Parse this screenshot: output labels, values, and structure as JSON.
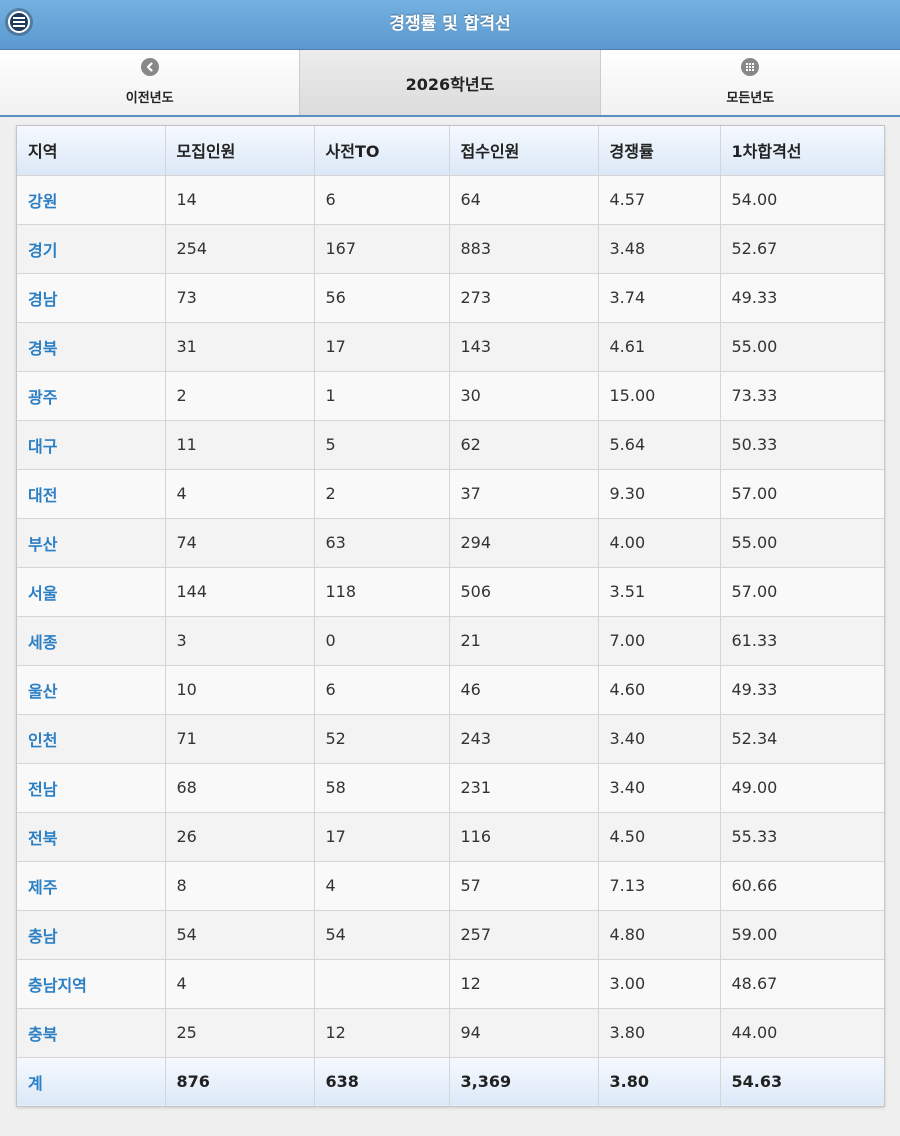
{
  "header": {
    "title": "경쟁률 및 합격선",
    "menu_icon": "menu-icon"
  },
  "nav": {
    "prev_label": "이전년도",
    "prev_icon": "chevron-left-icon",
    "current_label": "2026학년도",
    "all_label": "모든년도",
    "all_icon": "grid-icon"
  },
  "table": {
    "columns": [
      "지역",
      "모집인원",
      "사전TO",
      "접수인원",
      "경쟁률",
      "1차합격선"
    ],
    "rows": [
      [
        "강원",
        "14",
        "6",
        "64",
        "4.57",
        "54.00"
      ],
      [
        "경기",
        "254",
        "167",
        "883",
        "3.48",
        "52.67"
      ],
      [
        "경남",
        "73",
        "56",
        "273",
        "3.74",
        "49.33"
      ],
      [
        "경북",
        "31",
        "17",
        "143",
        "4.61",
        "55.00"
      ],
      [
        "광주",
        "2",
        "1",
        "30",
        "15.00",
        "73.33"
      ],
      [
        "대구",
        "11",
        "5",
        "62",
        "5.64",
        "50.33"
      ],
      [
        "대전",
        "4",
        "2",
        "37",
        "9.30",
        "57.00"
      ],
      [
        "부산",
        "74",
        "63",
        "294",
        "4.00",
        "55.00"
      ],
      [
        "서울",
        "144",
        "118",
        "506",
        "3.51",
        "57.00"
      ],
      [
        "세종",
        "3",
        "0",
        "21",
        "7.00",
        "61.33"
      ],
      [
        "울산",
        "10",
        "6",
        "46",
        "4.60",
        "49.33"
      ],
      [
        "인천",
        "71",
        "52",
        "243",
        "3.40",
        "52.34"
      ],
      [
        "전남",
        "68",
        "58",
        "231",
        "3.40",
        "49.00"
      ],
      [
        "전북",
        "26",
        "17",
        "116",
        "4.50",
        "55.33"
      ],
      [
        "제주",
        "8",
        "4",
        "57",
        "7.13",
        "60.66"
      ],
      [
        "충남",
        "54",
        "54",
        "257",
        "4.80",
        "59.00"
      ],
      [
        "충남지역",
        "4",
        "",
        "12",
        "3.00",
        "48.67"
      ],
      [
        "충북",
        "25",
        "12",
        "94",
        "3.80",
        "44.00"
      ]
    ],
    "total": [
      "계",
      "876",
      "638",
      "3,369",
      "3.80",
      "54.63"
    ]
  },
  "colors": {
    "header_bg": "#5b99cf",
    "region_link": "#2b7fc4"
  }
}
